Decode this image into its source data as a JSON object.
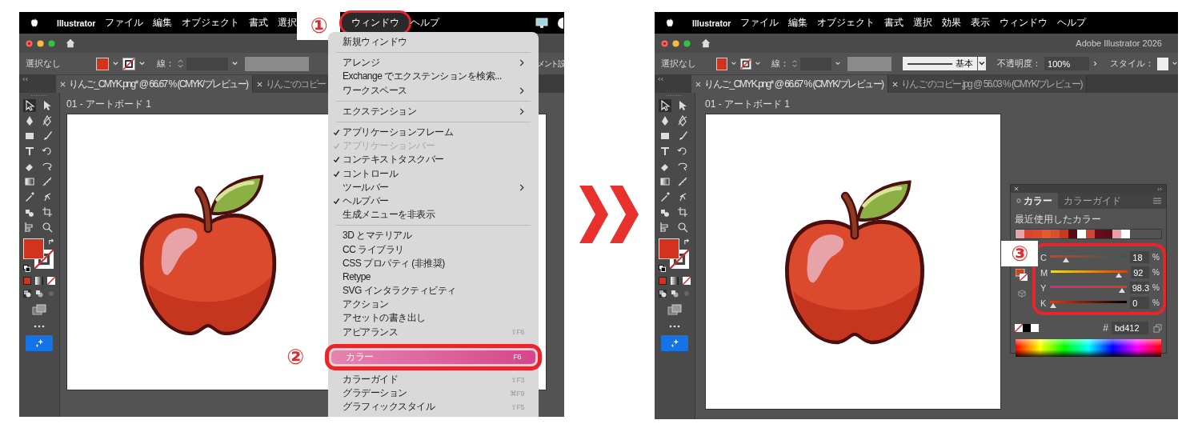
{
  "screens": [
    {
      "menu_bar": [
        {
          "label": "Illustrator",
          "selected": false
        },
        {
          "label": "ファイル",
          "selected": false
        },
        {
          "label": "編集",
          "selected": false
        },
        {
          "label": "オブジェクト",
          "selected": false
        },
        {
          "label": "書式",
          "selected": false
        },
        {
          "label": "選択",
          "selected": false
        },
        {
          "label": "ウィンドウ",
          "selected": true
        },
        {
          "label": "ヘルプ",
          "selected": false
        }
      ],
      "menu_callout": "①",
      "control_bar": {
        "selection": "選択なし",
        "stroke_label": "線：",
        "overflow_text": "メント設"
      },
      "tabs": [
        {
          "label": "りんご_CMYK.png* @ 66.67 % (CMYK/プレビュー)",
          "selected": true
        },
        {
          "label": "りんご のコピー",
          "selected": false
        }
      ],
      "artboard_label": "01 - アートボード 1",
      "window_menu": {
        "callout": "②",
        "groups": [
          {
            "items": [
              {
                "label": "新規ウィンドウ",
                "checked": false,
                "disabled": false,
                "submenu": false,
                "selected": false
              }
            ]
          },
          {
            "items": [
              {
                "label": "アレンジ",
                "checked": false,
                "disabled": false,
                "submenu": true,
                "selected": false
              },
              {
                "label": "Exchange でエクステンションを検索...",
                "checked": false,
                "disabled": false,
                "submenu": false,
                "selected": false
              },
              {
                "label": "ワークスペース",
                "checked": false,
                "disabled": false,
                "submenu": true,
                "selected": false
              }
            ]
          },
          {
            "items": [
              {
                "label": "エクステンション",
                "checked": false,
                "disabled": false,
                "submenu": true,
                "selected": false
              }
            ]
          },
          {
            "items": [
              {
                "label": "アプリケーションフレーム",
                "checked": true,
                "disabled": false,
                "submenu": false,
                "selected": false
              },
              {
                "label": "アプリケーションバー",
                "checked": true,
                "disabled": true,
                "submenu": false,
                "selected": false
              },
              {
                "label": "コンテキストタスクバー",
                "checked": true,
                "disabled": false,
                "submenu": false,
                "selected": false
              },
              {
                "label": "コントロール",
                "checked": true,
                "disabled": false,
                "submenu": false,
                "selected": false
              },
              {
                "label": "ツールバー",
                "checked": false,
                "disabled": false,
                "submenu": true,
                "selected": false
              },
              {
                "label": "ヘルプバー",
                "checked": true,
                "disabled": false,
                "submenu": false,
                "selected": false
              },
              {
                "label": "生成メニューを非表示",
                "checked": false,
                "disabled": false,
                "submenu": false,
                "selected": false
              }
            ]
          },
          {
            "items": [
              {
                "label": "3D とマテリアル",
                "checked": false,
                "disabled": false,
                "submenu": false,
                "selected": false
              },
              {
                "label": "CC ライブラリ",
                "checked": false,
                "disabled": false,
                "submenu": false,
                "selected": false
              },
              {
                "label": "CSS プロパティ (非推奨)",
                "checked": false,
                "disabled": false,
                "submenu": false,
                "selected": false
              },
              {
                "label": "Retype",
                "checked": false,
                "disabled": false,
                "submenu": false,
                "selected": false
              },
              {
                "label": "SVG インタラクティビティ",
                "checked": false,
                "disabled": false,
                "submenu": false,
                "selected": false
              },
              {
                "label": "アクション",
                "checked": false,
                "disabled": false,
                "submenu": false,
                "selected": false
              },
              {
                "label": "アセットの書き出し",
                "checked": false,
                "disabled": false,
                "submenu": false,
                "selected": false
              },
              {
                "label": "アピアランス",
                "shortcut": "⇧F6",
                "checked": false,
                "disabled": false,
                "submenu": false,
                "selected": false
              },
              {
                "label": "カラー",
                "shortcut": "F6",
                "checked": false,
                "disabled": false,
                "submenu": false,
                "selected": true
              },
              {
                "label": "カラーガイド",
                "shortcut": "⇧F3",
                "checked": false,
                "disabled": false,
                "submenu": false,
                "selected": false
              },
              {
                "label": "グラデーション",
                "shortcut": "⌘F9",
                "checked": false,
                "disabled": false,
                "submenu": false,
                "selected": false
              },
              {
                "label": "グラフィックスタイル",
                "shortcut": "⇧F5",
                "checked": false,
                "disabled": false,
                "submenu": false,
                "selected": false
              }
            ]
          }
        ]
      }
    },
    {
      "menu_bar": [
        {
          "label": "Illustrator",
          "selected": false
        },
        {
          "label": "ファイル",
          "selected": false
        },
        {
          "label": "編集",
          "selected": false
        },
        {
          "label": "オブジェクト",
          "selected": false
        },
        {
          "label": "書式",
          "selected": false
        },
        {
          "label": "選択",
          "selected": false
        },
        {
          "label": "効果",
          "selected": false
        },
        {
          "label": "表示",
          "selected": false
        },
        {
          "label": "ウィンドウ",
          "selected": false
        },
        {
          "label": "ヘルプ",
          "selected": false
        }
      ],
      "app_title": "Adobe Illustrator 2026",
      "control_bar": {
        "selection": "選択なし",
        "stroke_label": "線：",
        "stroke_style": "基本",
        "opacity_label": "不透明度：",
        "opacity": "100%",
        "style_label": "スタイル："
      },
      "tabs": [
        {
          "label": "りんご_CMYK.png* @ 66.67 % (CMYK/プレビュー)",
          "selected": true
        },
        {
          "label": "りんご のコピー.jpg @ 56.03 % (CMYK/プレビュー)",
          "selected": false
        }
      ],
      "artboard_label": "01 - アートボード 1",
      "color_panel": {
        "callout": "③",
        "tabs": [
          {
            "label": "カラー",
            "selected": true
          },
          {
            "label": "カラーガイド",
            "selected": false
          }
        ],
        "recent_label": "最近使用したカラー",
        "recent_swatches": [
          {
            "color": "#e8a3a8"
          },
          {
            "color": "#d8452c"
          },
          {
            "color": "#e0482a"
          },
          {
            "color": "#e55a2e"
          },
          {
            "color": "#d9502d"
          },
          {
            "color": "#c9381f"
          },
          {
            "color": "#5a0a12"
          },
          {
            "color": "#ffffff"
          },
          {
            "color": "#d14530"
          },
          {
            "color": "#6a0a18"
          },
          {
            "color": "#5e0c16"
          },
          {
            "color": "#e8a0a8"
          },
          {
            "color": "#ffffff"
          }
        ],
        "sliders": [
          {
            "label": "C",
            "level": 0.18,
            "value": "18",
            "unit": "%"
          },
          {
            "label": "M",
            "level": 0.92,
            "value": "92",
            "unit": "%"
          },
          {
            "label": "Y",
            "level": 0.983,
            "value": "98.3",
            "unit": "%"
          },
          {
            "label": "K",
            "level": 0,
            "value": "0",
            "unit": "%"
          }
        ],
        "hex_prefix": "#",
        "hex": "bd412"
      }
    }
  ]
}
